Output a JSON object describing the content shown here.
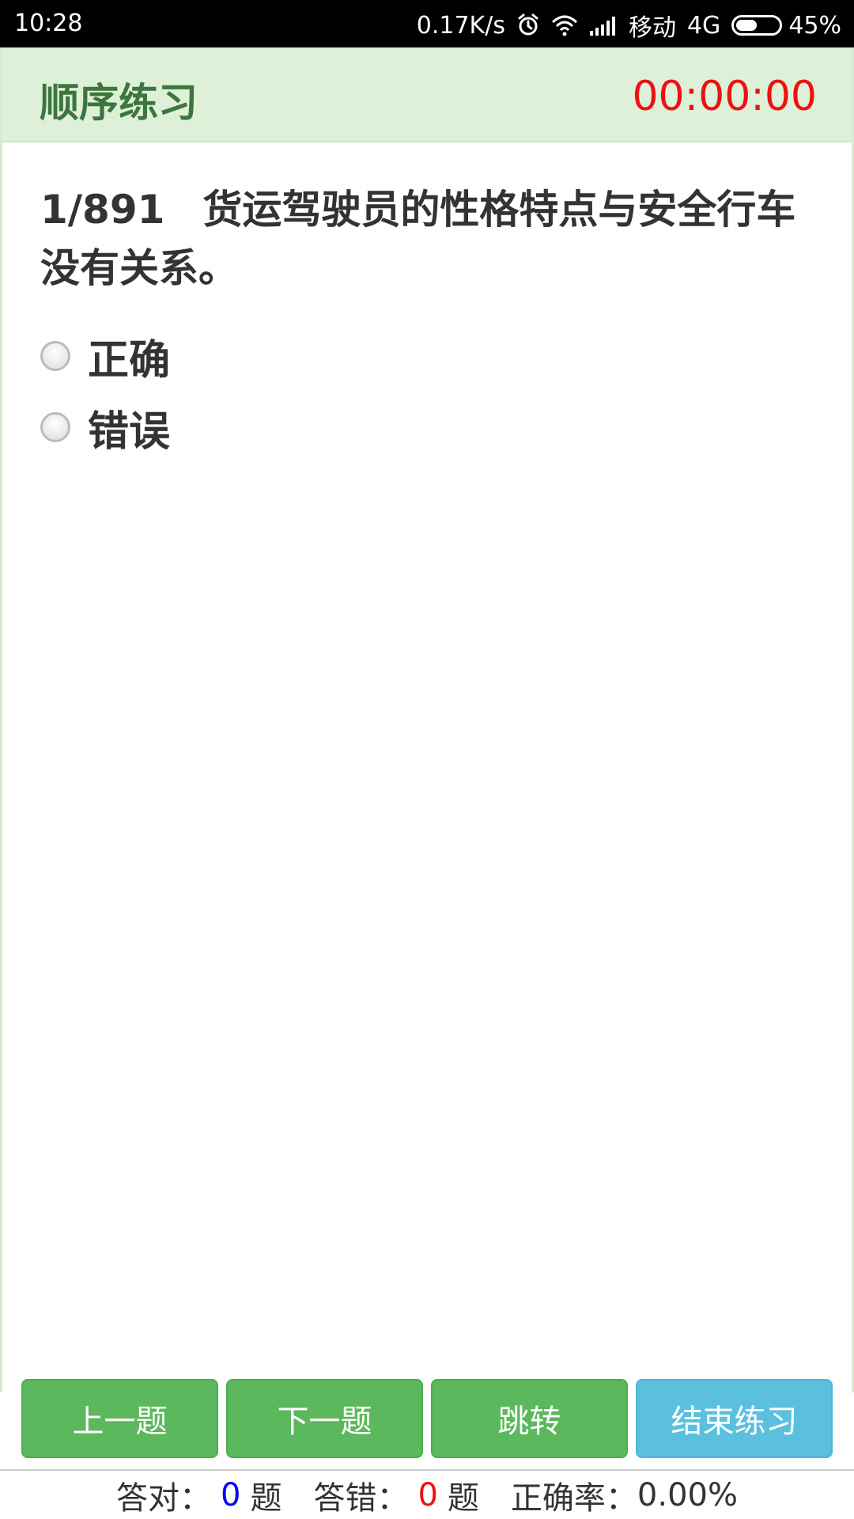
{
  "status_bar": {
    "time": "10:28",
    "net_speed": "0.17K/s",
    "carrier": "移动",
    "network": "4G",
    "battery": "45%"
  },
  "header": {
    "title": "顺序练习",
    "timer": "00:00:00"
  },
  "question": {
    "number": "1/891",
    "text": "货运驾驶员的性格特点与安全行车没有关系。"
  },
  "options": [
    {
      "label": "正确"
    },
    {
      "label": "错误"
    }
  ],
  "buttons": {
    "prev": "上一题",
    "next": "下一题",
    "jump": "跳转",
    "end": "结束练习"
  },
  "stats": {
    "correct_label": "答对：",
    "correct_count": "0",
    "unit": "题",
    "wrong_label": "答错：",
    "wrong_count": "0",
    "rate_label": "正确率：",
    "rate_value": "0.00%"
  },
  "colors": {
    "header_bg": "#dff0d8",
    "title": "#3c763d",
    "timer": "#ee1111",
    "green_button": "#5cb85c",
    "blue_button": "#5bc0de",
    "correct_count": "#0000ff",
    "wrong_count": "#ee1111"
  }
}
